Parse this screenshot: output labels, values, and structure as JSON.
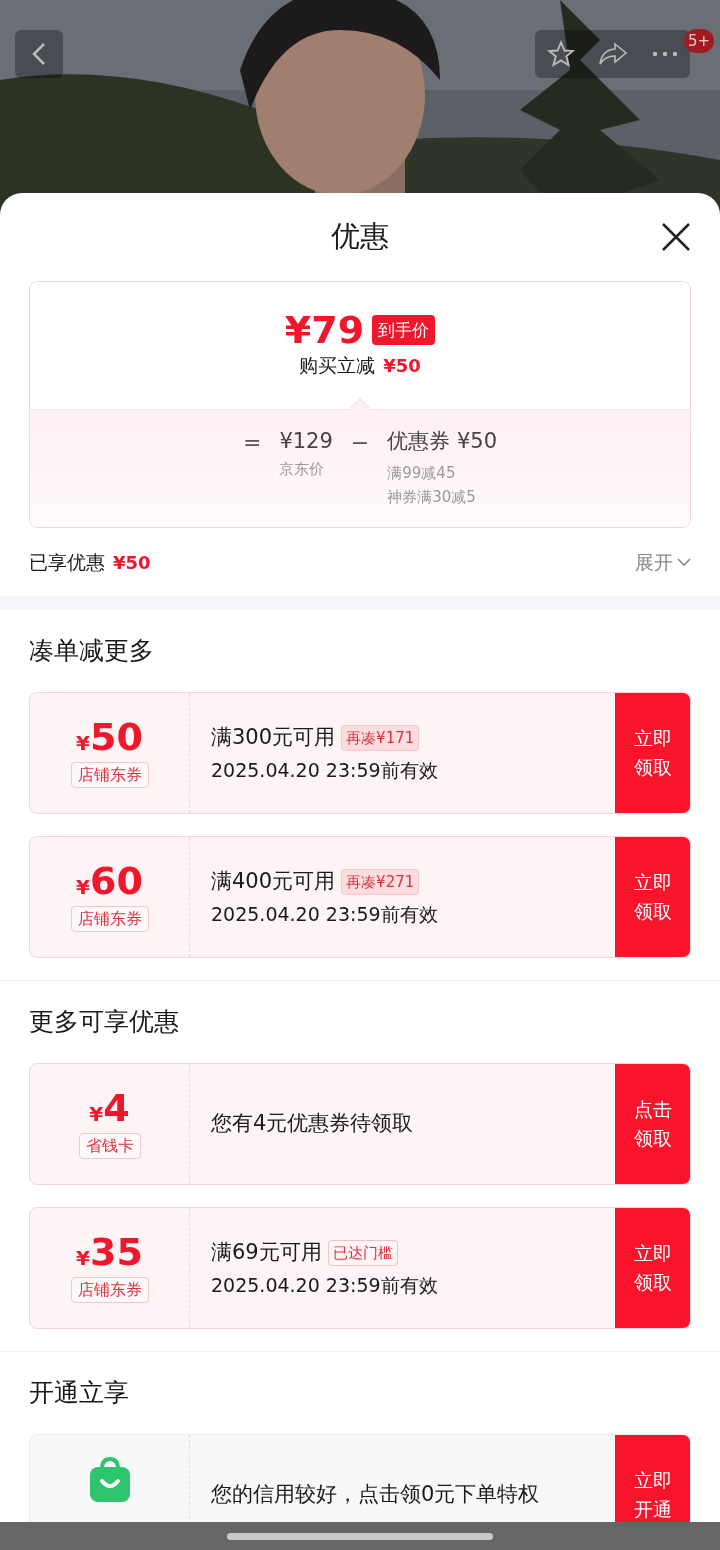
{
  "header": {
    "badge": "5+"
  },
  "sheet": {
    "title": "优惠"
  },
  "price_card": {
    "final_price": "¥79",
    "final_label": "到手价",
    "instant_label": "购买立减",
    "instant_value": "¥50",
    "equals": "=",
    "original_price": "¥129",
    "original_label": "京东价",
    "minus": "−",
    "coupon_label": "优惠券 ¥50",
    "coupon_details": [
      "满99减45",
      "神券满30减5"
    ]
  },
  "summary": {
    "label": "已享优惠",
    "value": "¥50",
    "expand": "展开",
    "expanded": false
  },
  "sections": [
    {
      "title": "凑单减更多",
      "items": [
        {
          "kind": "coupon",
          "currency": "¥",
          "amount": "50",
          "tag": "店铺东券",
          "condition": "满300元可用",
          "badge": {
            "text": "再凑¥171",
            "reached": false
          },
          "validity": "2025.04.20 23:59前有效",
          "button": [
            "立即",
            "领取"
          ]
        },
        {
          "kind": "coupon",
          "currency": "¥",
          "amount": "60",
          "tag": "店铺东券",
          "condition": "满400元可用",
          "badge": {
            "text": "再凑¥271",
            "reached": false
          },
          "validity": "2025.04.20 23:59前有效",
          "button": [
            "立即",
            "领取"
          ]
        }
      ]
    },
    {
      "title": "更多可享优惠",
      "items": [
        {
          "kind": "coupon",
          "currency": "¥",
          "amount": "4",
          "tag": "省钱卡",
          "condition": "您有4元优惠券待领取",
          "button": [
            "点击",
            "领取"
          ]
        },
        {
          "kind": "coupon",
          "currency": "¥",
          "amount": "35",
          "tag": "店铺东券",
          "condition": "满69元可用",
          "badge": {
            "text": "已达门槛",
            "reached": true
          },
          "validity": "2025.04.20 23:59前有效",
          "button": [
            "立即",
            "领取"
          ]
        }
      ]
    },
    {
      "title": "开通立享",
      "items": [
        {
          "kind": "credit",
          "condition": "您的信用较好，点击领0元下单特权",
          "button": [
            "立即",
            "开通"
          ]
        }
      ]
    }
  ]
}
